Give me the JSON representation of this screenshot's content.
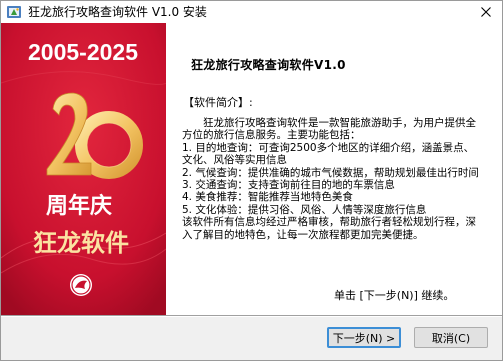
{
  "window": {
    "title": "狂龙旅行攻略查询软件 V1.0 安装"
  },
  "banner": {
    "years": "2005-2025",
    "big_number": "20",
    "anniversary": "周年庆",
    "brand": "狂龙软件",
    "colors": {
      "background": "#c8102e",
      "gold": "#f3c463"
    }
  },
  "content": {
    "heading": "狂龙旅行攻略查询软件V1.0",
    "intro_label": "【软件简介】:",
    "body": "　　狂龙旅行攻略查询软件是一款智能旅游助手，为用户提供全方位的旅行信息服务。主要功能包括：\n1. 目的地查询：可查询2500多个地区的详细介绍，涵盖景点、文化、风俗等实用信息\n2. 气候查询：提供准确的城市气候数据，帮助规划最佳出行时间\n3. 交通查询：支持查询前往目的地的车票信息\n4. 美食推荐：智能推荐当地特色美食\n5. 文化体验：提供习俗、风俗、人情等深度旅行信息\n该软件所有信息均经过严格审核，帮助旅行者轻松规划行程，深入了解目的地特色，让每一次旅程都更加完美便捷。",
    "next_hint": "单击 [下一步(N)] 继续。"
  },
  "buttons": {
    "next": "下一步(N) >",
    "cancel": "取消(C)"
  }
}
